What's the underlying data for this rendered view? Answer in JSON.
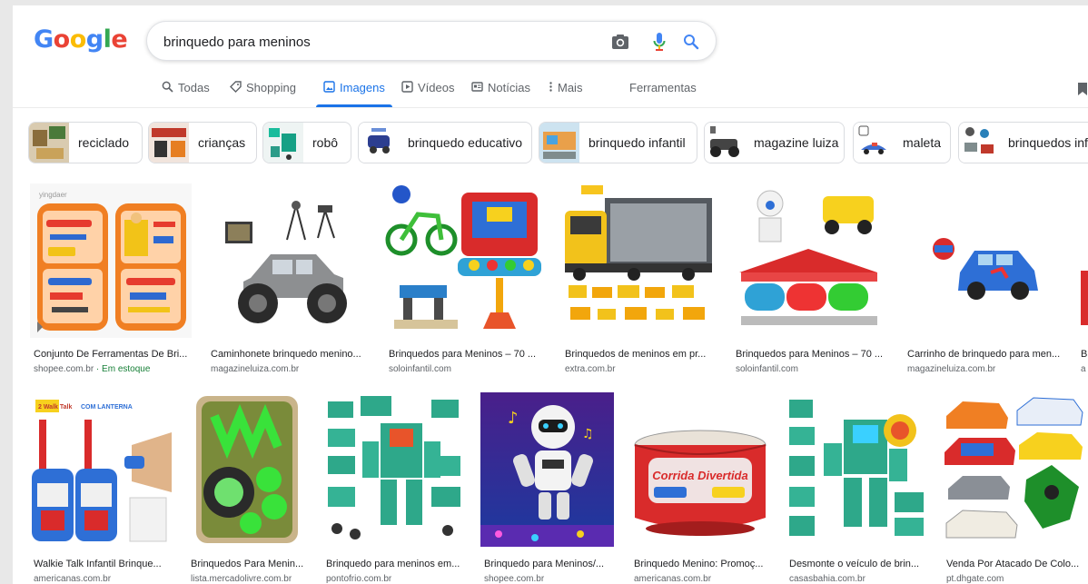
{
  "logo": {
    "letters": [
      "G",
      "o",
      "o",
      "g",
      "l",
      "e"
    ]
  },
  "search": {
    "query": "brinquedo para meninos",
    "icons": [
      "camera-icon",
      "microphone-icon",
      "search-icon"
    ]
  },
  "tabs": [
    {
      "label": "Todas",
      "icon": "search-icon"
    },
    {
      "label": "Shopping",
      "icon": "tag-icon"
    },
    {
      "label": "Imagens",
      "icon": "image-icon",
      "active": true
    },
    {
      "label": "Vídeos",
      "icon": "play-icon"
    },
    {
      "label": "Notícias",
      "icon": "news-icon"
    },
    {
      "label": "Mais",
      "icon": "more-icon"
    }
  ],
  "tools_label": "Ferramentas",
  "chips": [
    "reciclado",
    "crianças",
    "robô",
    "brinquedo educativo",
    "brinquedo infantil",
    "magazine luiza",
    "maleta",
    "brinquedos infa"
  ],
  "results_row1": [
    {
      "title": "Conjunto De Ferramentas De Bri...",
      "source": "shopee.com.br",
      "extra": " · Em estoque",
      "brand": "yingdaer"
    },
    {
      "title": "Caminhonete brinquedo menino...",
      "source": "magazineluiza.com.br"
    },
    {
      "title": "Brinquedos para Meninos – 70 ...",
      "source": "soloinfantil.com"
    },
    {
      "title": "Brinquedos de meninos em pr...",
      "source": "extra.com.br"
    },
    {
      "title": "Brinquedos para Meninos – 70 ...",
      "source": "soloinfantil.com"
    },
    {
      "title": "Carrinho de brinquedo para men...",
      "source": "magazineluiza.com.br"
    },
    {
      "title": "B",
      "source": "a"
    }
  ],
  "results_row2": [
    {
      "title": "Walkie Talk Infantil Brinque...",
      "source": "americanas.com.br",
      "badges": [
        "2 Walk Talk",
        "COM LANTERNA"
      ]
    },
    {
      "title": "Brinquedos Para Menin...",
      "source": "lista.mercadolivre.com.br"
    },
    {
      "title": "Brinquedo para meninos em...",
      "source": "pontofrio.com.br"
    },
    {
      "title": "Brinquedo para Meninos/...",
      "source": "shopee.com.br"
    },
    {
      "title": "Brinquedo Menino: Promoç...",
      "source": "americanas.com.br",
      "product_text": "Corrida Divertida"
    },
    {
      "title": "Desmonte o veículo de brin...",
      "source": "casasbahia.com.br"
    },
    {
      "title": "Venda Por Atacado De Colo...",
      "source": "pt.dhgate.com"
    }
  ],
  "colors": {
    "accent": "#1a73e8",
    "text": "#202124",
    "muted": "#5f6368",
    "stock": "#188038"
  }
}
